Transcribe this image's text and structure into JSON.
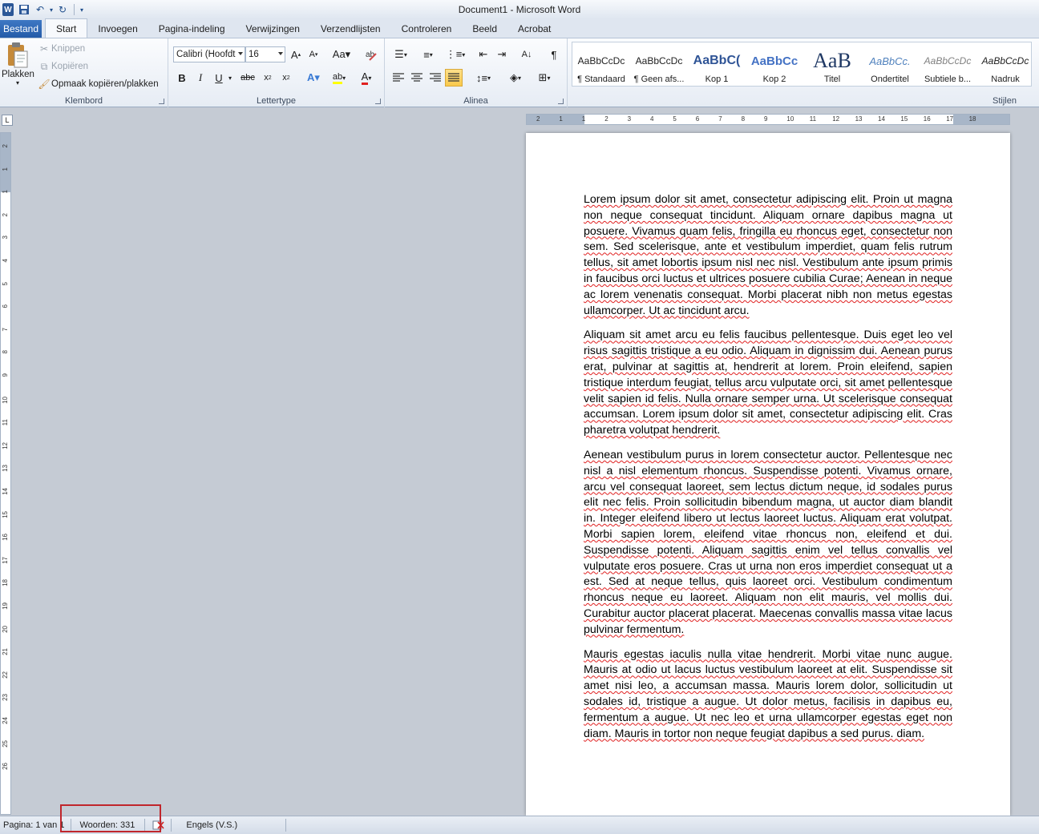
{
  "window": {
    "title": "Document1  -  Microsoft Word"
  },
  "tabs": [
    "Bestand",
    "Start",
    "Invoegen",
    "Pagina-indeling",
    "Verwijzingen",
    "Verzendlijsten",
    "Controleren",
    "Beeld",
    "Acrobat"
  ],
  "clipboard": {
    "paste": "Plakken",
    "cut": "Knippen",
    "copy": "Kopiëren",
    "format_painter": "Opmaak kopiëren/plakken",
    "label": "Klembord"
  },
  "font": {
    "name": "Calibri (Hoofdt",
    "size": "16",
    "label": "Lettertype"
  },
  "paragraph": {
    "label": "Alinea"
  },
  "styles": {
    "label": "Stijlen",
    "items": [
      {
        "sample": "AaBbCcDc",
        "name": "¶ Standaard"
      },
      {
        "sample": "AaBbCcDc",
        "name": "¶ Geen afs..."
      },
      {
        "sample": "AaBbC(",
        "name": "Kop 1"
      },
      {
        "sample": "AaBbCc",
        "name": "Kop 2"
      },
      {
        "sample": "AaB",
        "name": "Titel"
      },
      {
        "sample": "AaBbCc.",
        "name": "Ondertitel"
      },
      {
        "sample": "AaBbCcDc",
        "name": "Subtiele b..."
      },
      {
        "sample": "AaBbCcDc",
        "name": "Nadruk"
      }
    ]
  },
  "ruler": {
    "h_ticks": [
      "2",
      "1",
      "1",
      "2",
      "3",
      "4",
      "5",
      "6",
      "7",
      "8",
      "9",
      "10",
      "11",
      "12",
      "13",
      "14",
      "15",
      "16",
      "17",
      "18"
    ],
    "v_ticks": [
      "2",
      "1",
      "1",
      "2",
      "3",
      "4",
      "5",
      "6",
      "7",
      "8",
      "9",
      "10",
      "11",
      "12",
      "13",
      "14",
      "15",
      "16",
      "17",
      "18",
      "19",
      "20",
      "21",
      "22",
      "23",
      "24",
      "25",
      "26"
    ]
  },
  "document": {
    "paragraphs": [
      "Lorem ipsum dolor sit amet, consectetur adipiscing elit. Proin ut magna non neque consequat tincidunt. Aliquam ornare dapibus magna ut posuere. Vivamus quam felis, fringilla eu rhoncus eget, consectetur non sem. Sed scelerisque, ante et vestibulum imperdiet, quam felis rutrum tellus, sit amet lobortis ipsum nisl nec nisl. Vestibulum ante ipsum primis in faucibus orci luctus et ultrices posuere cubilia Curae; Aenean in neque ac lorem venenatis consequat. Morbi placerat nibh non metus egestas ullamcorper. Ut ac tincidunt arcu.",
      "Aliquam sit amet arcu eu felis faucibus pellentesque. Duis eget leo vel risus sagittis tristique a eu odio. Aliquam in dignissim dui. Aenean purus erat, pulvinar at sagittis at, hendrerit at lorem. Proin eleifend, sapien tristique interdum feugiat, tellus arcu vulputate orci, sit amet pellentesque velit sapien id felis. Nulla ornare semper urna. Ut scelerisque consequat accumsan. Lorem ipsum dolor sit amet, consectetur adipiscing elit. Cras pharetra volutpat hendrerit.",
      "Aenean vestibulum purus in lorem consectetur auctor. Pellentesque nec nisl a nisl elementum rhoncus. Suspendisse potenti. Vivamus ornare, arcu vel consequat laoreet, sem lectus dictum neque, id sodales purus elit nec felis. Proin sollicitudin bibendum magna, ut auctor diam blandit in. Integer eleifend libero ut lectus laoreet luctus. Aliquam erat volutpat. Morbi sapien lorem, eleifend vitae rhoncus non, eleifend et dui. Suspendisse potenti. Aliquam sagittis enim vel tellus convallis vel vulputate eros posuere. Cras ut urna non eros imperdiet consequat ut a est. Sed at neque tellus, quis laoreet orci. Vestibulum condimentum rhoncus neque eu laoreet. Aliquam non elit mauris, vel mollis dui. Curabitur auctor placerat placerat. Maecenas convallis massa vitae lacus pulvinar fermentum.",
      "Mauris egestas iaculis nulla vitae hendrerit. Morbi vitae nunc augue. Mauris at odio ut lacus luctus vestibulum laoreet at elit. Suspendisse sit amet nisi leo, a accumsan massa. Mauris lorem dolor, sollicitudin ut sodales id, tristique a augue. Ut dolor metus, facilisis in dapibus eu, fermentum a augue. Ut nec leo et urna ullamcorper egestas eget non diam. Mauris in tortor non neque feugiat dapibus a sed purus. diam."
    ]
  },
  "status": {
    "page": "Pagina: 1 van 1",
    "words": "Woorden: 331",
    "language": "Engels (V.S.)"
  },
  "colors": {
    "file_tab": "#2e66b3",
    "highlight_box": "#c0262c",
    "spelling": "#e02020"
  }
}
